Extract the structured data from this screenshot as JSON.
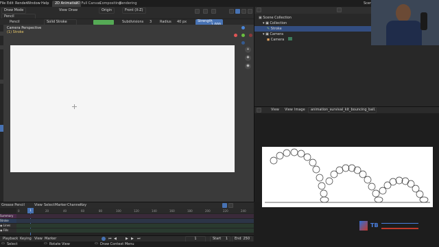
{
  "app_title": "Blender",
  "topbar": {
    "menus": [
      "File",
      "Edit",
      "Render",
      "Window",
      "Help"
    ],
    "workspaces": [
      "2D Animation",
      "2D Full Canvas",
      "Compositing",
      "Rendering"
    ],
    "active_workspace": "2D Animation",
    "scene_label": "Scene",
    "layer_label": "View Layer"
  },
  "viewport_header": {
    "mode": "Draw Mode",
    "view_menu": "View",
    "draw_menu": "Draw",
    "pivot": "Origin",
    "view_dropdown": "Front (X-Z)",
    "camera_icon": "camera-icon"
  },
  "tool_settings": {
    "brush": "Pencil",
    "stroke_type": "Solid Stroke",
    "subdivisions_label": "Subdivisions",
    "subdivisions_value": "3",
    "radius_label": "Radius",
    "radius_value": "40 px",
    "strength_label": "Strength",
    "strength_value": "1.000"
  },
  "viewport": {
    "view_name": "Camera Perspective",
    "object_name": "(1) Stroke"
  },
  "outliner": {
    "rows": [
      {
        "label": "Scene Collection",
        "indent": 0
      },
      {
        "label": "Collection",
        "indent": 1
      },
      {
        "label": "Stroke",
        "indent": 2,
        "selected": true
      },
      {
        "label": "Camera",
        "indent": 1
      },
      {
        "label": "Camera",
        "indent": 2
      }
    ]
  },
  "image_editor": {
    "view_menu": "View",
    "view2_menu": "View",
    "image_menu": "Image",
    "image_name": "animation_survival_kit_bouncing_ball.png"
  },
  "dopesheet": {
    "mode": "Grease Pencil",
    "menus": [
      "View",
      "Select",
      "Marker",
      "Channel",
      "Key"
    ],
    "frames": [
      "0",
      "20",
      "40",
      "60",
      "80",
      "100",
      "120",
      "140",
      "160",
      "180",
      "200",
      "220",
      "240"
    ],
    "current_frame": "1",
    "channels": [
      "Summary",
      "Stroke",
      "Lines",
      "Fills"
    ]
  },
  "timeline": {
    "menus": [
      "Playback",
      "Keying",
      "View",
      "Marker"
    ],
    "current_frame": "1",
    "start_label": "Start",
    "start_value": "1",
    "end_label": "End",
    "end_value": "250"
  },
  "statusbar": {
    "left": "Select",
    "mid": "Rotate View",
    "right": "Draw Context Menu"
  },
  "watermark": "TB",
  "colors": {
    "accent": "#4772b3",
    "panel_bg": "#303030",
    "canvas": "#f5f5f5",
    "header_bg": "#1d1d1d",
    "green_btn": "#55aa55"
  }
}
